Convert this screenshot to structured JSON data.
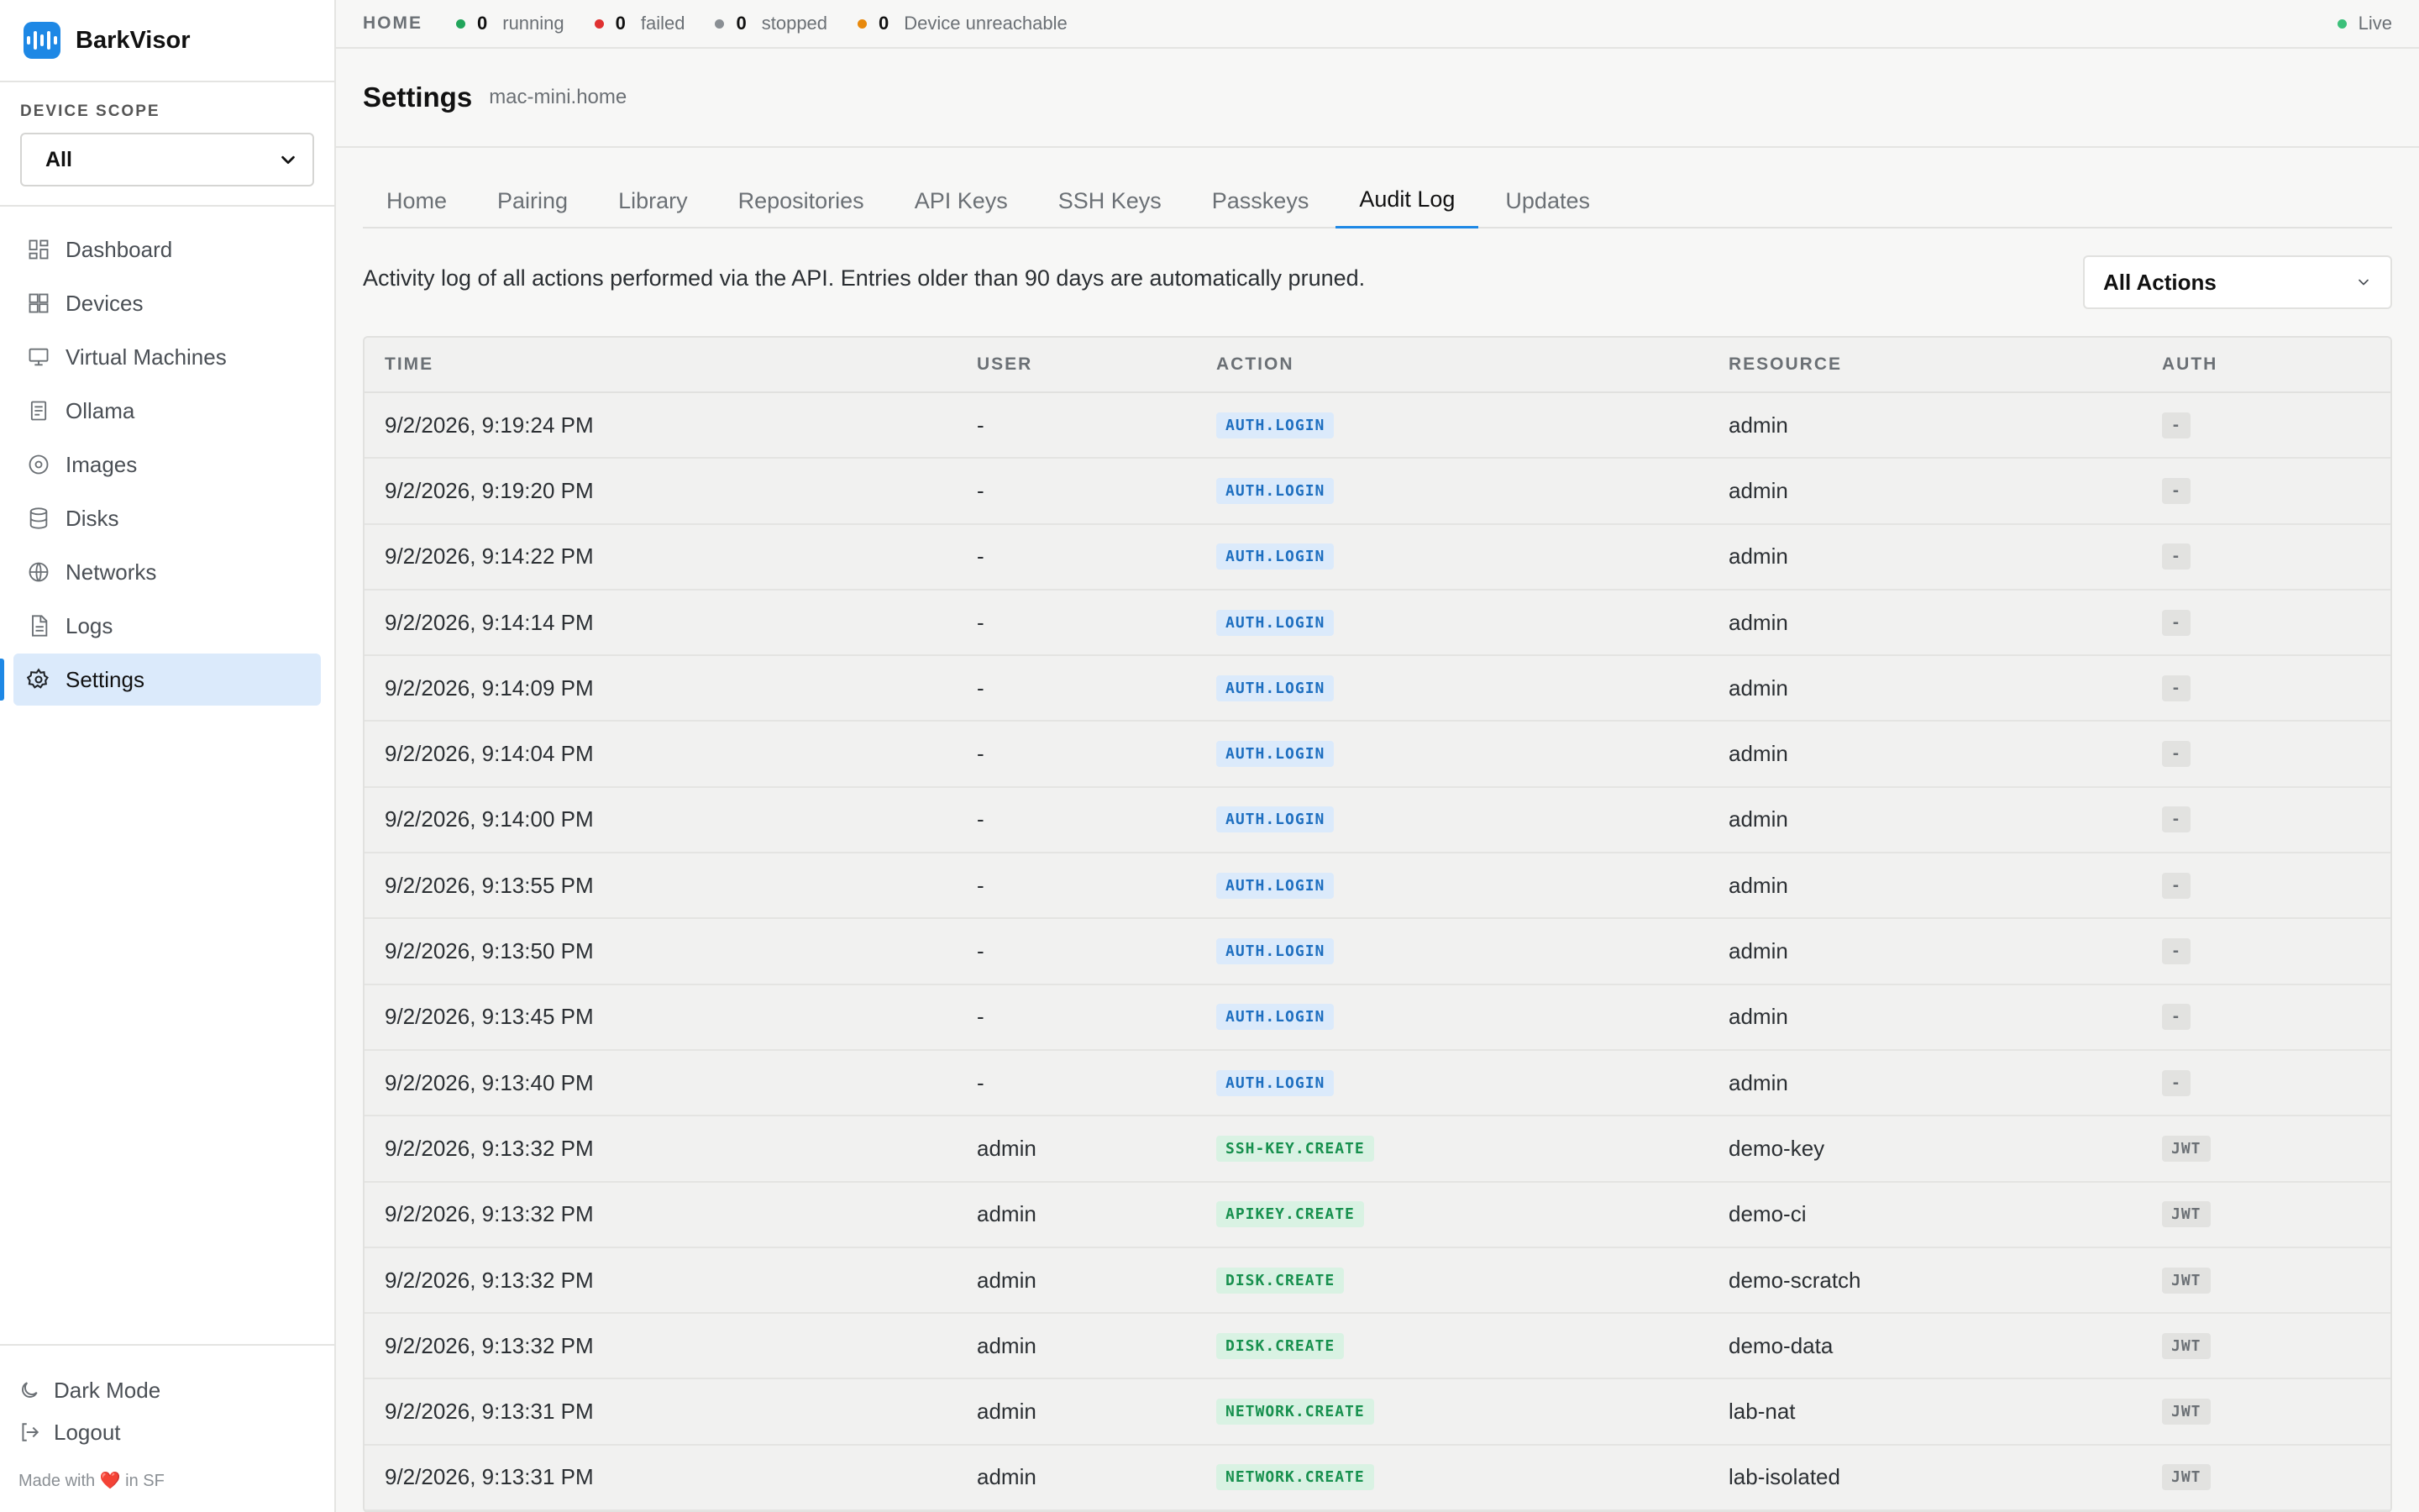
{
  "app": {
    "name": "BarkVisor"
  },
  "sidebar": {
    "scope_label": "DEVICE SCOPE",
    "scope_value": "All",
    "items": [
      {
        "label": "Dashboard",
        "icon": "dashboard-icon"
      },
      {
        "label": "Devices",
        "icon": "devices-icon"
      },
      {
        "label": "Virtual Machines",
        "icon": "monitor-icon"
      },
      {
        "label": "Ollama",
        "icon": "ollama-icon"
      },
      {
        "label": "Images",
        "icon": "disc-icon"
      },
      {
        "label": "Disks",
        "icon": "database-icon"
      },
      {
        "label": "Networks",
        "icon": "globe-icon"
      },
      {
        "label": "Logs",
        "icon": "file-text-icon"
      },
      {
        "label": "Settings",
        "icon": "gear-icon",
        "active": true
      }
    ],
    "footer": {
      "dark_mode": "Dark Mode",
      "logout": "Logout",
      "made_with": "Made with ❤️ in SF"
    }
  },
  "topbar": {
    "crumb": "HOME",
    "stats": [
      {
        "count": "0",
        "label": "running",
        "color": "#22a55b"
      },
      {
        "count": "0",
        "label": "failed",
        "color": "#e03131"
      },
      {
        "count": "0",
        "label": "stopped",
        "color": "#8a8f94"
      },
      {
        "count": "0",
        "label": "Device unreachable",
        "color": "#e8890c"
      }
    ],
    "live": "Live",
    "live_color": "#3cc07a"
  },
  "header": {
    "title": "Settings",
    "subtitle": "mac-mini.home"
  },
  "tabs": [
    {
      "label": "Home"
    },
    {
      "label": "Pairing"
    },
    {
      "label": "Library"
    },
    {
      "label": "Repositories"
    },
    {
      "label": "API Keys"
    },
    {
      "label": "SSH Keys"
    },
    {
      "label": "Passkeys"
    },
    {
      "label": "Audit Log",
      "active": true
    },
    {
      "label": "Updates"
    }
  ],
  "audit": {
    "description": "Activity log of all actions performed via the API. Entries older than 90 days are automatically pruned.",
    "filter_value": "All Actions",
    "columns": {
      "time": "TIME",
      "user": "USER",
      "action": "ACTION",
      "resource": "RESOURCE",
      "auth": "AUTH"
    },
    "rows": [
      {
        "time": "9/2/2026, 9:19:24 PM",
        "user": "-",
        "action": "AUTH.LOGIN",
        "resource": "admin",
        "auth": "-"
      },
      {
        "time": "9/2/2026, 9:19:20 PM",
        "user": "-",
        "action": "AUTH.LOGIN",
        "resource": "admin",
        "auth": "-"
      },
      {
        "time": "9/2/2026, 9:14:22 PM",
        "user": "-",
        "action": "AUTH.LOGIN",
        "resource": "admin",
        "auth": "-"
      },
      {
        "time": "9/2/2026, 9:14:14 PM",
        "user": "-",
        "action": "AUTH.LOGIN",
        "resource": "admin",
        "auth": "-"
      },
      {
        "time": "9/2/2026, 9:14:09 PM",
        "user": "-",
        "action": "AUTH.LOGIN",
        "resource": "admin",
        "auth": "-"
      },
      {
        "time": "9/2/2026, 9:14:04 PM",
        "user": "-",
        "action": "AUTH.LOGIN",
        "resource": "admin",
        "auth": "-"
      },
      {
        "time": "9/2/2026, 9:14:00 PM",
        "user": "-",
        "action": "AUTH.LOGIN",
        "resource": "admin",
        "auth": "-"
      },
      {
        "time": "9/2/2026, 9:13:55 PM",
        "user": "-",
        "action": "AUTH.LOGIN",
        "resource": "admin",
        "auth": "-"
      },
      {
        "time": "9/2/2026, 9:13:50 PM",
        "user": "-",
        "action": "AUTH.LOGIN",
        "resource": "admin",
        "auth": "-"
      },
      {
        "time": "9/2/2026, 9:13:45 PM",
        "user": "-",
        "action": "AUTH.LOGIN",
        "resource": "admin",
        "auth": "-"
      },
      {
        "time": "9/2/2026, 9:13:40 PM",
        "user": "-",
        "action": "AUTH.LOGIN",
        "resource": "admin",
        "auth": "-"
      },
      {
        "time": "9/2/2026, 9:13:32 PM",
        "user": "admin",
        "action": "SSH-KEY.CREATE",
        "resource": "demo-key",
        "auth": "JWT"
      },
      {
        "time": "9/2/2026, 9:13:32 PM",
        "user": "admin",
        "action": "APIKEY.CREATE",
        "resource": "demo-ci",
        "auth": "JWT"
      },
      {
        "time": "9/2/2026, 9:13:32 PM",
        "user": "admin",
        "action": "DISK.CREATE",
        "resource": "demo-scratch",
        "auth": "JWT"
      },
      {
        "time": "9/2/2026, 9:13:32 PM",
        "user": "admin",
        "action": "DISK.CREATE",
        "resource": "demo-data",
        "auth": "JWT"
      },
      {
        "time": "9/2/2026, 9:13:31 PM",
        "user": "admin",
        "action": "NETWORK.CREATE",
        "resource": "lab-nat",
        "auth": "JWT"
      },
      {
        "time": "9/2/2026, 9:13:31 PM",
        "user": "admin",
        "action": "NETWORK.CREATE",
        "resource": "lab-isolated",
        "auth": "JWT"
      }
    ]
  }
}
